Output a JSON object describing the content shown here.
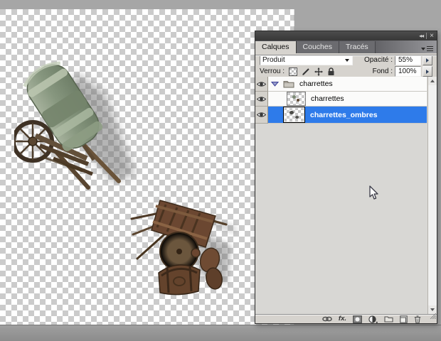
{
  "window": {
    "icons": {
      "collapse": "◂◂",
      "close": "×"
    }
  },
  "panel": {
    "tabs": [
      {
        "label": "Calques",
        "active": true
      },
      {
        "label": "Couches",
        "active": false
      },
      {
        "label": "Tracés",
        "active": false
      }
    ],
    "controls": {
      "blend_mode_value": "Produit",
      "opacity_label": "Opacité :",
      "opacity_value": "55%",
      "lock_label": "Verrou :",
      "fill_label": "Fond :",
      "fill_value": "100%"
    },
    "layers": [
      {
        "type": "group",
        "name": "charrettes",
        "expanded": true,
        "visible": true,
        "selected": false
      },
      {
        "type": "layer",
        "name": "charrettes",
        "visible": true,
        "selected": false
      },
      {
        "type": "layer",
        "name": "charrettes_ombres",
        "visible": true,
        "selected": true
      }
    ],
    "bottom_bar": {
      "fx_label": "fx.",
      "icons": [
        "link-layers",
        "layer-style",
        "layer-mask",
        "adjustment-layer",
        "new-group",
        "new-layer",
        "delete-layer"
      ]
    }
  },
  "canvas": {
    "objects": [
      "covered-wagon",
      "overturned-cart-with-barrels"
    ],
    "transparency_grid": true
  },
  "colors": {
    "selection_blue": "#2e7bea",
    "panel_bg": "#d6d3ce",
    "panel_header": "#3f3f3f",
    "workspace_gray": "#a6a6a6",
    "checker_light": "#ffffff",
    "checker_dark": "#cbcbcb"
  }
}
